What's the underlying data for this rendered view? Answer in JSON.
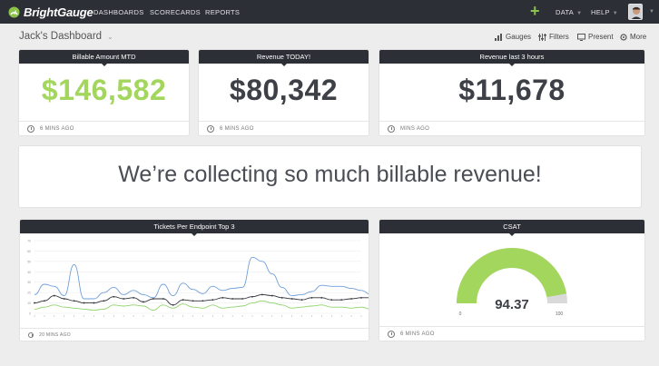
{
  "app": {
    "logo_text": "BrightGauge"
  },
  "nav": {
    "items": [
      {
        "label": "DASHBOARDS"
      },
      {
        "label": "SCORECARDS"
      },
      {
        "label": "REPORTS"
      }
    ],
    "data_label": "DATA",
    "help_label": "HELP"
  },
  "dashboard": {
    "title": "Jack's Dashboard"
  },
  "toolbar": {
    "gauges_label": "Gauges",
    "filters_label": "Filters",
    "present_label": "Present",
    "more_label": "More"
  },
  "widgets": {
    "billable": {
      "title": "Billable Amount MTD",
      "value": "$146,582",
      "value_color": "#a3d65c",
      "updated": "6 MINS AGO"
    },
    "revenue_today": {
      "title": "Revenue TODAY!",
      "value": "$80,342",
      "value_color": "#3d4046",
      "updated": "6 MINS AGO"
    },
    "revenue_3h": {
      "title": "Revenue last 3 hours",
      "value": "$11,678",
      "value_color": "#3d4046",
      "updated": "MINS AGO"
    },
    "banner": {
      "text": "We’re collecting so much billable revenue!"
    },
    "tickets": {
      "title": "Tickets Per Endpoint Top 3",
      "updated": "20 MINS AGO"
    },
    "csat": {
      "title": "CSAT",
      "value": "94.37",
      "min_label": "0",
      "max_label": "100",
      "updated": "6 MINS AGO",
      "gauge_color": "#a3d65c",
      "track_color": "#d9d9d9"
    }
  },
  "chart_data": {
    "type": "line",
    "title": "Tickets Per Endpoint Top 3",
    "ylim": [
      0,
      70
    ],
    "yticks": [
      "0",
      "10",
      "20",
      "30",
      "40",
      "50",
      "60",
      "70"
    ],
    "categories": [
      "A",
      "B",
      "C",
      "D",
      "E",
      "F",
      "G",
      "H",
      "I",
      "J",
      "K",
      "L",
      "M",
      "N",
      "O",
      "P",
      "Q",
      "R",
      "S",
      "T",
      "U",
      "V",
      "W",
      "X",
      "Y",
      "Z",
      "AA",
      "AB",
      "AC",
      "AD",
      "AE",
      "AF",
      "AG",
      "AH"
    ],
    "series": [
      {
        "color": "#6f9fd8",
        "values": [
          18,
          28,
          26,
          17,
          47,
          14,
          14,
          20,
          25,
          18,
          22,
          18,
          15,
          28,
          17,
          29,
          23,
          19,
          26,
          22,
          24,
          25,
          54,
          50,
          38,
          25,
          17,
          18,
          21,
          27,
          26,
          26,
          24,
          22,
          18
        ]
      },
      {
        "color": "#2f3238",
        "values": [
          10,
          12,
          17,
          14,
          12,
          10,
          10,
          12,
          16,
          14,
          15,
          11,
          14,
          14,
          8,
          13,
          12,
          12,
          13,
          15,
          14,
          14,
          16,
          18,
          17,
          15,
          14,
          13,
          15,
          15,
          13,
          13,
          14,
          15,
          15
        ]
      },
      {
        "color": "#8fd36a",
        "values": [
          4,
          6,
          8,
          6,
          5,
          4,
          3,
          4,
          8,
          7,
          8,
          7,
          3,
          8,
          5,
          9,
          6,
          5,
          8,
          5,
          6,
          7,
          10,
          12,
          10,
          8,
          5,
          6,
          7,
          8,
          6,
          6,
          5,
          6,
          4
        ]
      }
    ]
  }
}
